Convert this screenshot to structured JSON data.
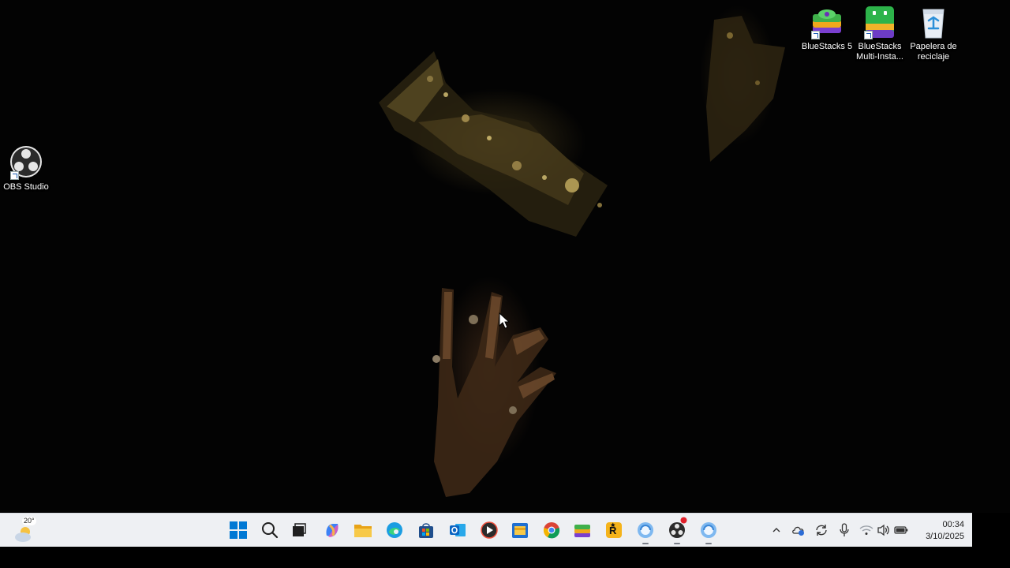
{
  "desktop": {
    "icons": [
      {
        "label": "BlueStacks 5"
      },
      {
        "label": "BlueStacks Multi-Insta..."
      },
      {
        "label": "Papelera de reciclaje"
      },
      {
        "label": "OBS Studio"
      }
    ]
  },
  "taskbar": {
    "weather": {
      "temp": "20°"
    },
    "pinned": [
      "start-icon",
      "search-icon",
      "task-view-icon",
      "copilot-icon",
      "file-explorer-icon",
      "edge-icon",
      "microsoft-store-icon",
      "outlook-icon",
      "media-player-icon",
      "explorer-folder-icon",
      "chrome-icon",
      "bluestacks-icon",
      "rockstar-launcher-icon",
      "app-icon",
      "obs-studio-icon",
      "app-icon-2"
    ],
    "tray": [
      "chevron-up-icon",
      "onedrive-icon",
      "sync-icon",
      "microphone-icon",
      "wifi-icon",
      "volume-icon",
      "battery-icon"
    ],
    "clock": {
      "time": "00:34",
      "date": "3/10/2025"
    }
  },
  "colors": {
    "taskbar_bg": "#eef0f3",
    "windows_blue": "#0078d4"
  }
}
